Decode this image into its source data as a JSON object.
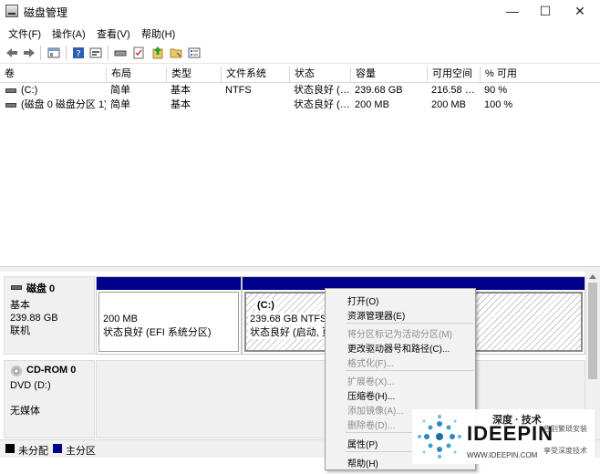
{
  "window": {
    "title": "磁盘管理",
    "minimize": "—",
    "maximize": "☐",
    "close": "✕"
  },
  "menu": [
    "文件(F)",
    "操作(A)",
    "查看(V)",
    "帮助(H)"
  ],
  "toolbar_icons": [
    "back-icon",
    "forward-icon",
    "console-icon",
    "help-icon",
    "properties-icon",
    "disk-icon",
    "check-icon",
    "refresh-icon",
    "folder-icon",
    "list-icon"
  ],
  "volume_table": {
    "headers": [
      "卷",
      "布局",
      "类型",
      "文件系统",
      "状态",
      "容量",
      "可用空间",
      "% 可用"
    ],
    "rows": [
      [
        "(C:)",
        "简单",
        "基本",
        "NTFS",
        "状态良好 (…",
        "239.68 GB",
        "216.58 …",
        "90 %"
      ],
      [
        "(磁盘 0 磁盘分区 1)",
        "简单",
        "基本",
        "",
        "状态良好 (…",
        "200 MB",
        "200 MB",
        "100 %"
      ]
    ]
  },
  "disks": [
    {
      "name": "磁盘 0",
      "type": "基本",
      "size": "239.88 GB",
      "status": "联机"
    },
    {
      "name": "CD-ROM 0",
      "type": "DVD (D:)",
      "size": "",
      "status": "无媒体"
    }
  ],
  "partitions": {
    "efi": {
      "size": "200 MB",
      "status": "状态良好 (EFI 系统分区)"
    },
    "c": {
      "name": "(C:)",
      "size": "239.68 GB NTFS",
      "status": "状态良好 (启动, 页"
    }
  },
  "legend": [
    {
      "label": "未分配",
      "color": "#000000"
    },
    {
      "label": "主分区",
      "color": "#00008b"
    }
  ],
  "context_menu": {
    "open": "打开(O)",
    "explorer": "资源管理器(E)",
    "mark_active": "将分区标记为活动分区(M)",
    "change_letter": "更改驱动器号和路径(C)...",
    "format": "格式化(F)...",
    "extend": "扩展卷(X)...",
    "shrink": "压缩卷(H)...",
    "add_mirror": "添加镜像(A)...",
    "delete": "删除卷(D)...",
    "properties": "属性(P)",
    "help": "帮助(H)"
  },
  "watermark": {
    "top": "深度 · 技术",
    "brand": "IDEEPIN",
    "url": "WWW.IDEEPIN.COM",
    "tag1": "告别繁琐安装",
    "tag2": "享受深度技术"
  },
  "colors": {
    "primary_partition": "#00008b",
    "unallocated": "#000000"
  }
}
